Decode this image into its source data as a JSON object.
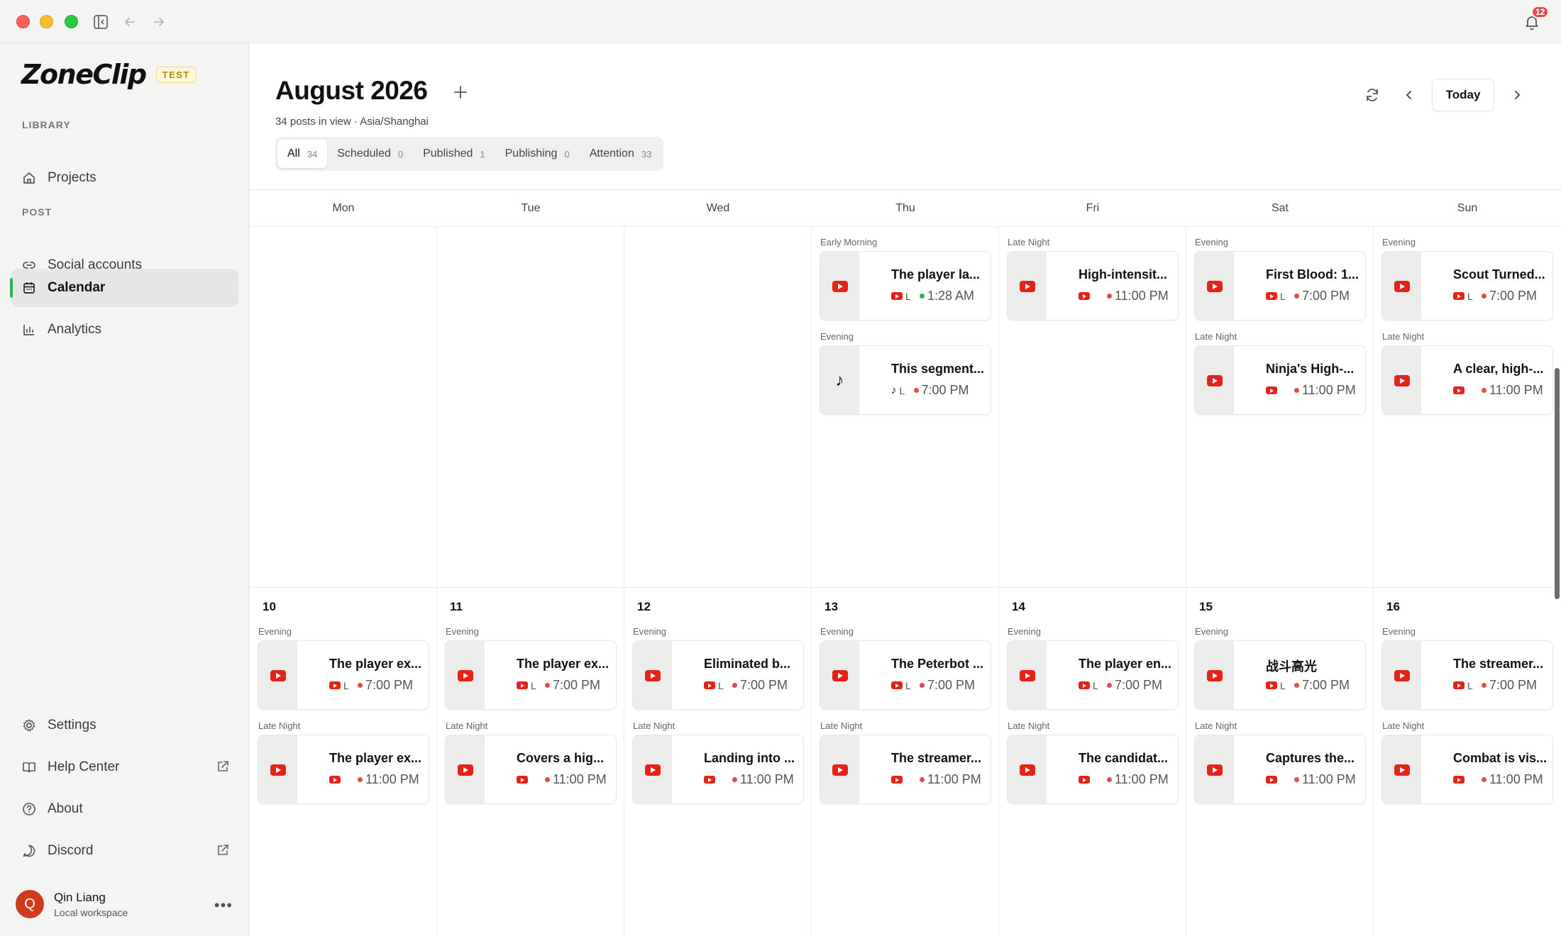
{
  "app": {
    "name": "ZoneClip",
    "badge": "TEST",
    "notifications": "12"
  },
  "sidebar": {
    "sections": {
      "library": "LIBRARY",
      "post": "POST"
    },
    "items": [
      {
        "label": "Projects",
        "icon": "home-icon"
      },
      {
        "label": "Social accounts",
        "icon": "link-icon"
      },
      {
        "label": "Calendar",
        "icon": "calendar-icon",
        "active": true
      },
      {
        "label": "Analytics",
        "icon": "bar-chart-icon"
      }
    ],
    "bottom": [
      {
        "label": "Settings",
        "icon": "gear-icon"
      },
      {
        "label": "Help Center",
        "icon": "book-icon"
      },
      {
        "label": "About",
        "icon": "help-circle-icon"
      },
      {
        "label": "Discord",
        "icon": "chat-bubble-icon"
      }
    ],
    "user": {
      "initial": "Q",
      "name": "Qin Liang",
      "workspace": "Local workspace"
    }
  },
  "header": {
    "title": "August 2026",
    "subtitle": "34 posts in view · Asia/Shanghai",
    "today": "Today",
    "filters": [
      {
        "label": "All",
        "count": "34",
        "active": true
      },
      {
        "label": "Scheduled",
        "count": "0"
      },
      {
        "label": "Published",
        "count": "1"
      },
      {
        "label": "Publishing",
        "count": "0"
      },
      {
        "label": "Attention",
        "count": "33"
      }
    ]
  },
  "calendar": {
    "days": [
      "Mon",
      "Tue",
      "Wed",
      "Thu",
      "Fri",
      "Sat",
      "Sun"
    ],
    "weeks": [
      {
        "dates": [
          "",
          "",
          "",
          "",
          "",
          "",
          ""
        ],
        "cells": [
          [],
          [],
          [],
          [
            {
              "slot": "Early Morning",
              "platform": "youtube",
              "title": "The player la...",
              "account": "L",
              "time": "1:28 AM",
              "status": "published"
            },
            {
              "slot": "Evening",
              "platform": "tiktok",
              "title": "This segment...",
              "account": "L",
              "time": "7:00 PM",
              "status": "attention"
            }
          ],
          [
            {
              "slot": "Late Night",
              "platform": "youtube",
              "title": "High-intensit...",
              "account": "",
              "time": "11:00 PM",
              "status": "attention"
            }
          ],
          [
            {
              "slot": "Evening",
              "platform": "youtube",
              "title": "First Blood: 1...",
              "account": "L",
              "time": "7:00 PM",
              "status": "attention"
            },
            {
              "slot": "Late Night",
              "platform": "youtube",
              "title": "Ninja's High-...",
              "account": "",
              "time": "11:00 PM",
              "status": "attention"
            }
          ],
          [
            {
              "slot": "Evening",
              "platform": "youtube",
              "title": "Scout Turned...",
              "account": "L",
              "time": "7:00 PM",
              "status": "attention"
            },
            {
              "slot": "Late Night",
              "platform": "youtube",
              "title": "A clear, high-...",
              "account": "",
              "time": "11:00 PM",
              "status": "attention"
            }
          ]
        ]
      },
      {
        "dates": [
          "10",
          "11",
          "12",
          "13",
          "14",
          "15",
          "16"
        ],
        "cells": [
          [
            {
              "slot": "Evening",
              "platform": "youtube",
              "title": "The player ex...",
              "account": "L",
              "time": "7:00 PM",
              "status": "attention"
            },
            {
              "slot": "Late Night",
              "platform": "youtube",
              "title": "The player ex...",
              "account": "",
              "time": "11:00 PM",
              "status": "attention"
            }
          ],
          [
            {
              "slot": "Evening",
              "platform": "youtube",
              "title": "The player ex...",
              "account": "L",
              "time": "7:00 PM",
              "status": "attention"
            },
            {
              "slot": "Late Night",
              "platform": "youtube",
              "title": "Covers a hig...",
              "account": "",
              "time": "11:00 PM",
              "status": "attention"
            }
          ],
          [
            {
              "slot": "Evening",
              "platform": "youtube",
              "title": "Eliminated b...",
              "account": "L",
              "time": "7:00 PM",
              "status": "attention"
            },
            {
              "slot": "Late Night",
              "platform": "youtube",
              "title": "Landing into ...",
              "account": "",
              "time": "11:00 PM",
              "status": "attention"
            }
          ],
          [
            {
              "slot": "Evening",
              "platform": "youtube",
              "title": "The Peterbot ...",
              "account": "L",
              "time": "7:00 PM",
              "status": "attention"
            },
            {
              "slot": "Late Night",
              "platform": "youtube",
              "title": "The streamer...",
              "account": "",
              "time": "11:00 PM",
              "status": "attention"
            }
          ],
          [
            {
              "slot": "Evening",
              "platform": "youtube",
              "title": "The player en...",
              "account": "L",
              "time": "7:00 PM",
              "status": "attention"
            },
            {
              "slot": "Late Night",
              "platform": "youtube",
              "title": "The candidat...",
              "account": "",
              "time": "11:00 PM",
              "status": "attention"
            }
          ],
          [
            {
              "slot": "Evening",
              "platform": "youtube",
              "title": "战斗高光",
              "account": "L",
              "time": "7:00 PM",
              "status": "attention"
            },
            {
              "slot": "Late Night",
              "platform": "youtube",
              "title": "Captures the...",
              "account": "",
              "time": "11:00 PM",
              "status": "attention"
            }
          ],
          [
            {
              "slot": "Evening",
              "platform": "youtube",
              "title": "The streamer...",
              "account": "L",
              "time": "7:00 PM",
              "status": "attention"
            },
            {
              "slot": "Late Night",
              "platform": "youtube",
              "title": "Combat is vis...",
              "account": "",
              "time": "11:00 PM",
              "status": "attention"
            }
          ]
        ]
      }
    ]
  },
  "colors": {
    "accent": "#2fb25a",
    "attention": "#e5484d",
    "youtube": "#e62117"
  }
}
